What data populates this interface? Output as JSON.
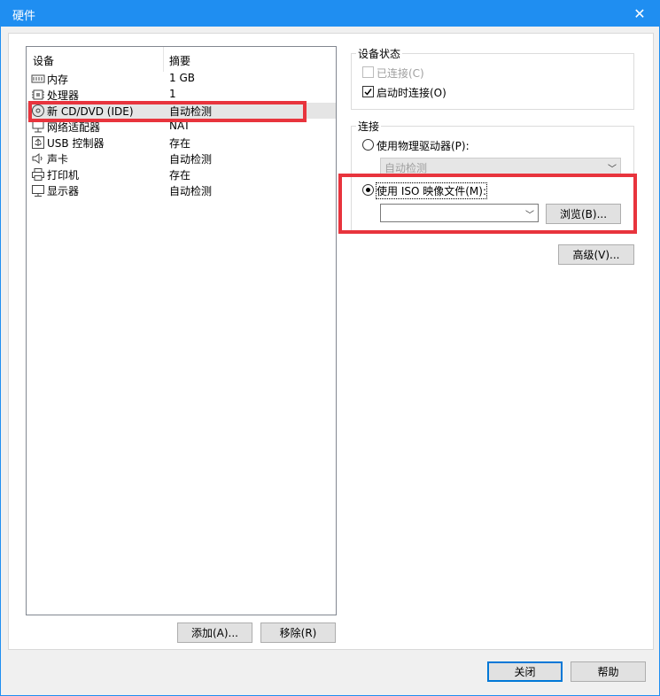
{
  "window": {
    "title": "硬件"
  },
  "device_list": {
    "headers": {
      "device": "设备",
      "summary": "摘要"
    },
    "rows": [
      {
        "name": "内存",
        "summary": "1 GB",
        "icon": "memory-icon"
      },
      {
        "name": "处理器",
        "summary": "1",
        "icon": "processor-icon"
      },
      {
        "name": "新 CD/DVD (IDE)",
        "summary": "自动检测",
        "icon": "cd-dvd-icon",
        "selected": true
      },
      {
        "name": "网络适配器",
        "summary": "NAT",
        "icon": "network-adapter-icon"
      },
      {
        "name": "USB 控制器",
        "summary": "存在",
        "icon": "usb-controller-icon"
      },
      {
        "name": "声卡",
        "summary": "自动检测",
        "icon": "sound-card-icon"
      },
      {
        "name": "打印机",
        "summary": "存在",
        "icon": "printer-icon"
      },
      {
        "name": "显示器",
        "summary": "自动检测",
        "icon": "display-icon"
      }
    ],
    "add_label": "添加(A)...",
    "remove_label": "移除(R)"
  },
  "device_status": {
    "title": "设备状态",
    "connected_label": "已连接(C)",
    "connected": false,
    "connect_on_power_label": "启动时连接(O)",
    "connect_on_power": true
  },
  "connection": {
    "title": "连接",
    "physical_label": "使用物理驱动器(P):",
    "physical_value": "自动检测",
    "iso_label": "使用 ISO 映像文件(M):",
    "iso_value": "",
    "browse_label": "浏览(B)...",
    "selected": "iso"
  },
  "advanced_label": "高级(V)...",
  "footer": {
    "close_label": "关闭",
    "help_label": "帮助"
  },
  "colors": {
    "titlebar": "#1f8ef1",
    "highlight": "#e8343d",
    "focus": "#0078d7"
  }
}
